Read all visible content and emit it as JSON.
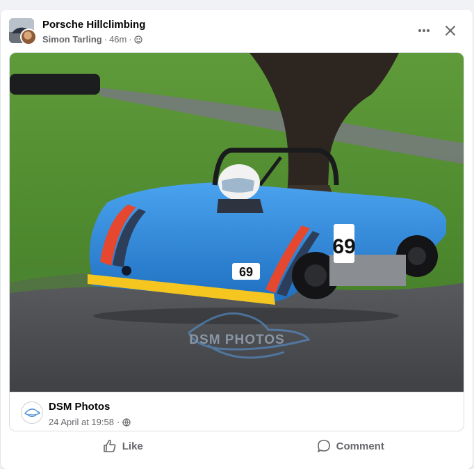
{
  "post": {
    "group_name": "Porsche Hillclimbing",
    "author": "Simon Tarling",
    "separator": "·",
    "time": "46m",
    "icons": {
      "more": "more-horizontal-icon",
      "close": "close-icon",
      "audience": "group-audience-icon"
    }
  },
  "shared": {
    "watermark": "DSM PHOTOS",
    "car_number": "69",
    "page_name": "DSM Photos",
    "date": "24 April at 19:58",
    "separator": "·",
    "audience_icon": "globe-icon"
  },
  "actions": {
    "like_label": "Like",
    "comment_label": "Comment",
    "icons": {
      "like": "thumbs-up-icon",
      "comment": "comment-bubble-icon"
    }
  },
  "colors": {
    "primary_text": "#050505",
    "secondary_text": "#65676b",
    "car_blue": "#2e8fe0",
    "stripe_red": "#e5482e",
    "stripe_yellow": "#f2c423"
  }
}
